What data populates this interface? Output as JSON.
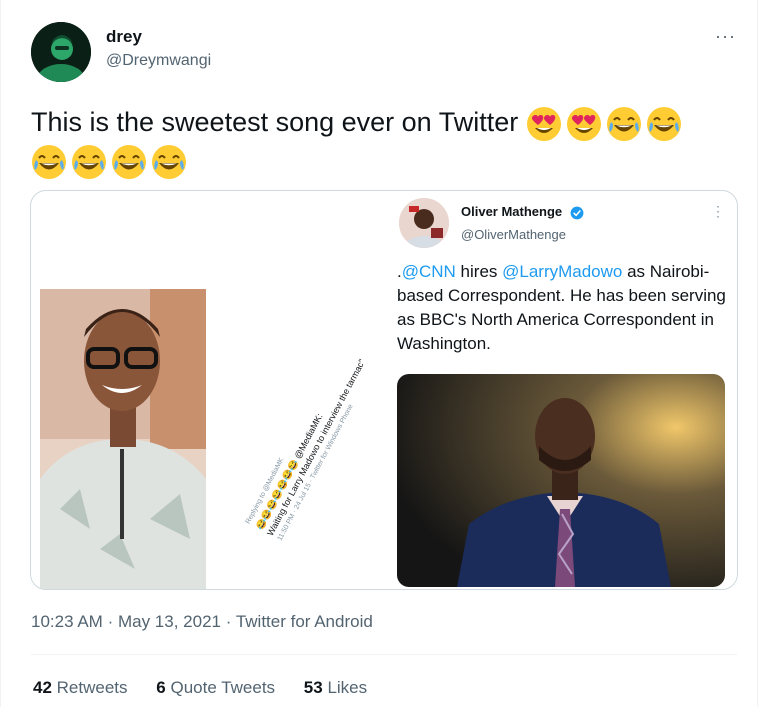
{
  "author": {
    "name": "drey",
    "handle": "@Dreymwangi"
  },
  "tweet": {
    "text": "This is the sweetest song ever on Twitter",
    "emojis": [
      "heart-eyes",
      "heart-eyes",
      "tears-of-joy",
      "tears-of-joy",
      "tears-of-joy",
      "tears-of-joy",
      "tears-of-joy",
      "tears-of-joy"
    ]
  },
  "more_icon": "···",
  "embedded_old_tweet": {
    "reply_line": "Replying to @MediaMK",
    "emoji_line": "😂😂😂😂😂😂😂 @MediaMK:",
    "text": "Waiting for Larry Madowo to interview the tarmac\"",
    "meta": "11:50 PM · 24 Jul 15 · Twitter for Windows Phone"
  },
  "quoted": {
    "name": "Oliver Mathenge",
    "handle": "@OliverMathenge",
    "more_icon": "⋮",
    "text_part1": ".",
    "link1": "@CNN",
    "text_part2": " hires ",
    "link2": "@LarryMadowo",
    "text_part3": " as Nairobi-based Correspondent. He has been serving as BBC's North America Correspondent in Washington."
  },
  "meta": {
    "time": "10:23 AM",
    "sep": "·",
    "date": "May 13, 2021",
    "sep2": "·",
    "source": "Twitter for Android"
  },
  "stats": [
    {
      "count": "42",
      "label": "Retweets"
    },
    {
      "count": "6",
      "label": "Quote Tweets"
    },
    {
      "count": "53",
      "label": "Likes"
    }
  ],
  "colors": {
    "link": "#1d9bf0",
    "secondary": "#536471",
    "border": "#cfd9de",
    "text": "#0f1419"
  }
}
